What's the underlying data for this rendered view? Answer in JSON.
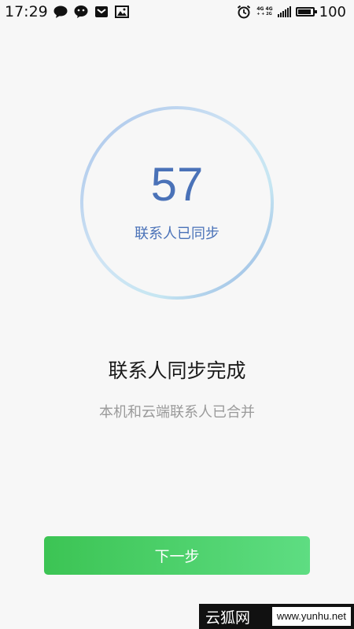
{
  "status_bar": {
    "time": "17:29",
    "notification_icons": [
      "chat-bubble-icon",
      "wechat-icon",
      "mail-icon",
      "gallery-icon"
    ],
    "network_top": "4G 4G",
    "network_bottom": "+ + 2G",
    "battery_level": 1.0,
    "battery_text": "100"
  },
  "sync_ring": {
    "count": "57",
    "label": "联系人已同步"
  },
  "result": {
    "title": "联系人同步完成",
    "subtitle": "本机和云端联系人已合并"
  },
  "next_button": {
    "label": "下一步"
  },
  "watermark": {
    "logo": "云狐网",
    "url": "www.yunhu.net"
  },
  "colors": {
    "background": "#f7f7f7",
    "accent_blue": "#4a72b8",
    "button_green": "#3cc454"
  }
}
